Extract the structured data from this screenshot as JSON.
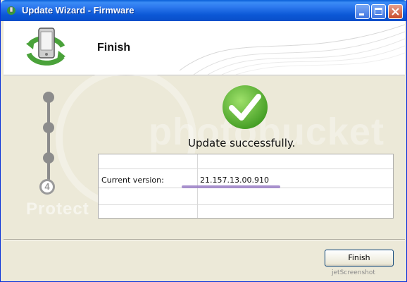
{
  "window": {
    "title": "Update Wizard - Firmware",
    "colors": {
      "titlebar": "#0a5fd8",
      "close": "#c94c2a",
      "body": "#ece9d8"
    }
  },
  "header": {
    "title": "Finish",
    "icon": "phone-update-icon"
  },
  "steps": {
    "total": 4,
    "current_number": "4",
    "icons": [
      "step-dot",
      "step-dot",
      "step-dot",
      "step-current"
    ]
  },
  "status": {
    "icon": "success-check-icon",
    "message": "Update successfully.",
    "color": "#5aa82a"
  },
  "info_table": {
    "rows": [
      {
        "label": "Current version:",
        "value": "21.157.13.00.910"
      }
    ]
  },
  "watermarks": {
    "brand": "photobucket",
    "protect": "Protect"
  },
  "footer": {
    "finish_label": "Finish",
    "corner_text": "jetScreenshot"
  }
}
